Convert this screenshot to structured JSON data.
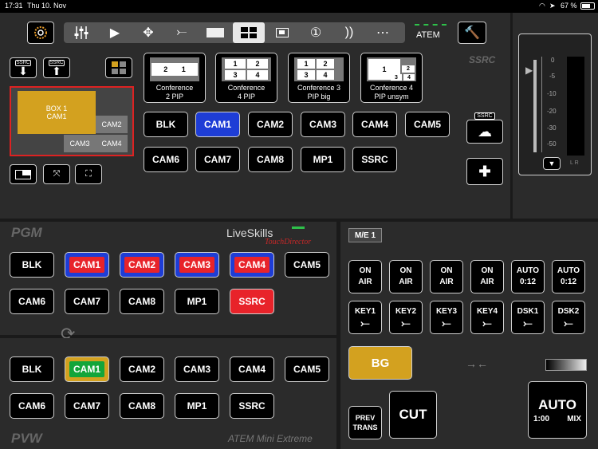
{
  "status_bar": {
    "time": "17:31",
    "date": "Thu 10. Nov",
    "battery": "67 %"
  },
  "toolbar": {
    "atem_label": "ATEM"
  },
  "ssrc_section": {
    "title": "SSRC",
    "down_badge": "SSRC",
    "up_badge": "SSRC",
    "preview": {
      "box_label_line1": "BOX 1",
      "box_label_line2": "CAM1",
      "cam2": "CAM2",
      "cam3": "CAM3",
      "cam4": "CAM4"
    },
    "presets": [
      {
        "line1": "Conference",
        "line2": "2 PIP"
      },
      {
        "line1": "Conference",
        "line2": "4 PIP"
      },
      {
        "line1": "Conference 3",
        "line2": "PIP big"
      },
      {
        "line1": "Conference 4",
        "line2": "PIP unsym"
      }
    ],
    "source_row1": [
      "BLK",
      "CAM1",
      "CAM2",
      "CAM3",
      "CAM4",
      "CAM5"
    ],
    "source_row2": [
      "CAM6",
      "CAM7",
      "CAM8",
      "MP1",
      "SSRC"
    ],
    "cloud_badge": "SSRC"
  },
  "audio_meter": {
    "ticks": [
      "0",
      "-5",
      "-10",
      "-20",
      "-30",
      "-50"
    ],
    "lr": "L R"
  },
  "pgm": {
    "title": "PGM",
    "brand": "LiveSkills",
    "brand_sub": "TouchDirector",
    "row1": [
      "BLK",
      "CAM1",
      "CAM2",
      "CAM3",
      "CAM4",
      "CAM5"
    ],
    "row2": [
      "CAM6",
      "CAM7",
      "CAM8",
      "MP1",
      "SSRC"
    ]
  },
  "pvw": {
    "title": "PVW",
    "device": "ATEM Mini Extreme",
    "row1": [
      "BLK",
      "CAM1",
      "CAM2",
      "CAM3",
      "CAM4",
      "CAM5"
    ],
    "row2": [
      "CAM6",
      "CAM7",
      "CAM8",
      "MP1",
      "SSRC"
    ]
  },
  "me": {
    "label": "M/E 1",
    "on_air": [
      {
        "l1": "ON",
        "l2": "AIR"
      },
      {
        "l1": "ON",
        "l2": "AIR"
      },
      {
        "l1": "ON",
        "l2": "AIR"
      },
      {
        "l1": "ON",
        "l2": "AIR"
      },
      {
        "l1": "AUTO",
        "l2": "0:12"
      },
      {
        "l1": "AUTO",
        "l2": "0:12"
      }
    ],
    "keys": [
      "KEY1",
      "KEY2",
      "KEY3",
      "KEY4",
      "DSK1",
      "DSK2"
    ],
    "bg": "BG",
    "prev_trans_1": "PREV",
    "prev_trans_2": "TRANS",
    "cut": "CUT",
    "auto": "AUTO",
    "auto_rate": "1:00",
    "auto_mix": "MIX"
  },
  "colors": {
    "program_red": "#e8232a",
    "preview_green": "#13a53a",
    "gold": "#d3a11f",
    "blue": "#1e3dd6"
  }
}
